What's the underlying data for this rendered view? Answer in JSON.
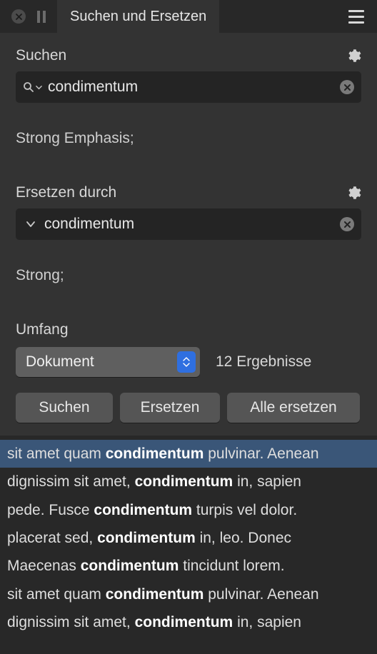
{
  "titlebar": {
    "tab_title": "Suchen und Ersetzen"
  },
  "search": {
    "label": "Suchen",
    "value": "condimentum",
    "format": "Strong Emphasis;"
  },
  "replace": {
    "label": "Ersetzen durch",
    "value": "condimentum",
    "format": "Strong;"
  },
  "scope": {
    "label": "Umfang",
    "selected": "Dokument",
    "results": "12 Ergebnisse"
  },
  "buttons": {
    "search": "Suchen",
    "replace": "Ersetzen",
    "replace_all": "Alle ersetzen"
  },
  "results": [
    {
      "before": "sit amet quam ",
      "match": "condimentum",
      "after": " pulvinar. Aenean",
      "selected": true
    },
    {
      "before": "dignissim sit amet, ",
      "match": "condimentum",
      "after": " in, sapien",
      "selected": false
    },
    {
      "before": "pede. Fusce ",
      "match": "condimentum",
      "after": " turpis vel dolor.",
      "selected": false
    },
    {
      "before": "placerat sed, ",
      "match": "condimentum",
      "after": " in, leo. Donec",
      "selected": false
    },
    {
      "before": "Maecenas ",
      "match": "condimentum",
      "after": " tincidunt lorem.",
      "selected": false
    },
    {
      "before": "sit amet quam ",
      "match": "condimentum",
      "after": " pulvinar. Aenean",
      "selected": false
    },
    {
      "before": "dignissim sit amet, ",
      "match": "condimentum",
      "after": " in, sapien",
      "selected": false
    }
  ]
}
